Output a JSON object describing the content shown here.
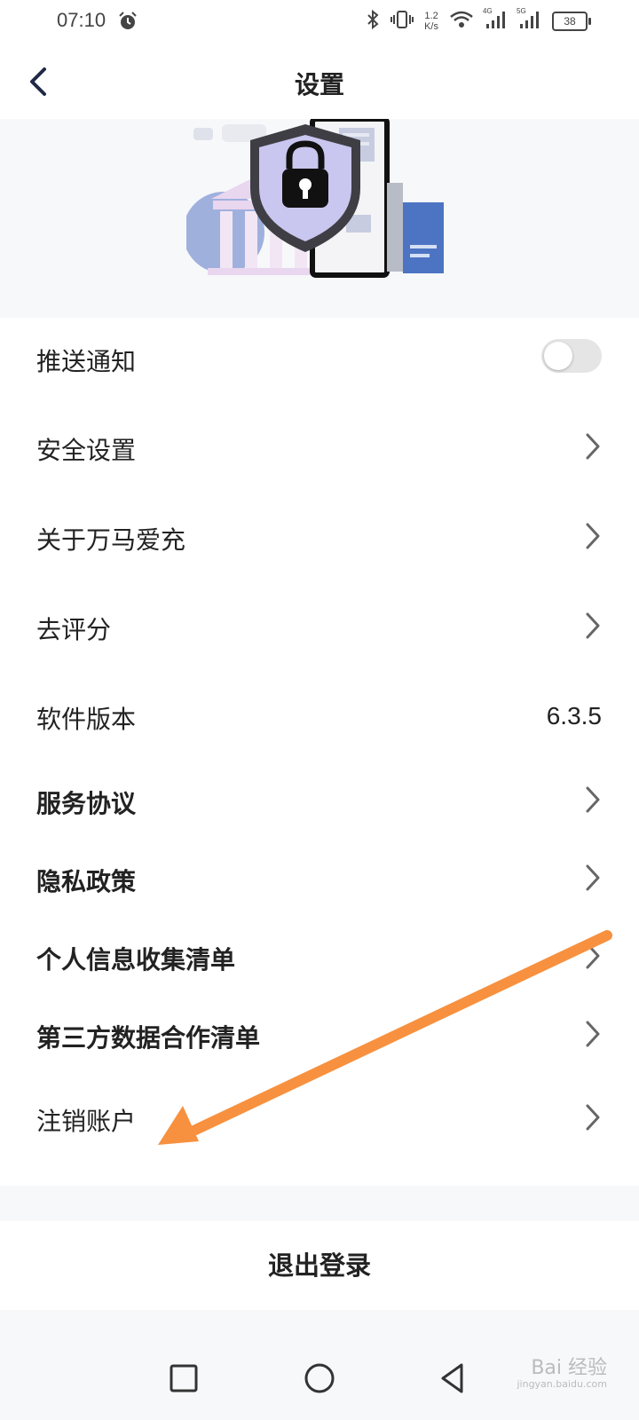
{
  "status_bar": {
    "time": "07:10",
    "speed_value": "1.2",
    "speed_unit": "K/s",
    "signal_1": "4G",
    "signal_2": "5G",
    "battery": "38"
  },
  "header": {
    "title": "设置",
    "back_icon": "chevron-left-icon"
  },
  "banner": {
    "illustration": "security-shield-lock-illustration"
  },
  "settings": {
    "push_notification": {
      "label": "推送通知",
      "enabled": false
    },
    "items": [
      {
        "label": "安全设置"
      },
      {
        "label": "关于万马爱充"
      },
      {
        "label": "去评分"
      }
    ],
    "version": {
      "label": "软件版本",
      "value": "6.3.5"
    },
    "bold_items": [
      {
        "label": "服务协议"
      },
      {
        "label": "隐私政策"
      },
      {
        "label": "个人信息收集清单"
      },
      {
        "label": "第三方数据合作清单"
      }
    ],
    "cancel_account": {
      "label": "注销账户"
    }
  },
  "logout": {
    "label": "退出登录"
  },
  "colors": {
    "annotation_arrow": "#f7913f",
    "toggle_off": "#e5e5e5",
    "page_background": "#f7f8fa"
  },
  "watermark": {
    "brand": "Bai  经验",
    "site": "jingyan.baidu.com"
  }
}
